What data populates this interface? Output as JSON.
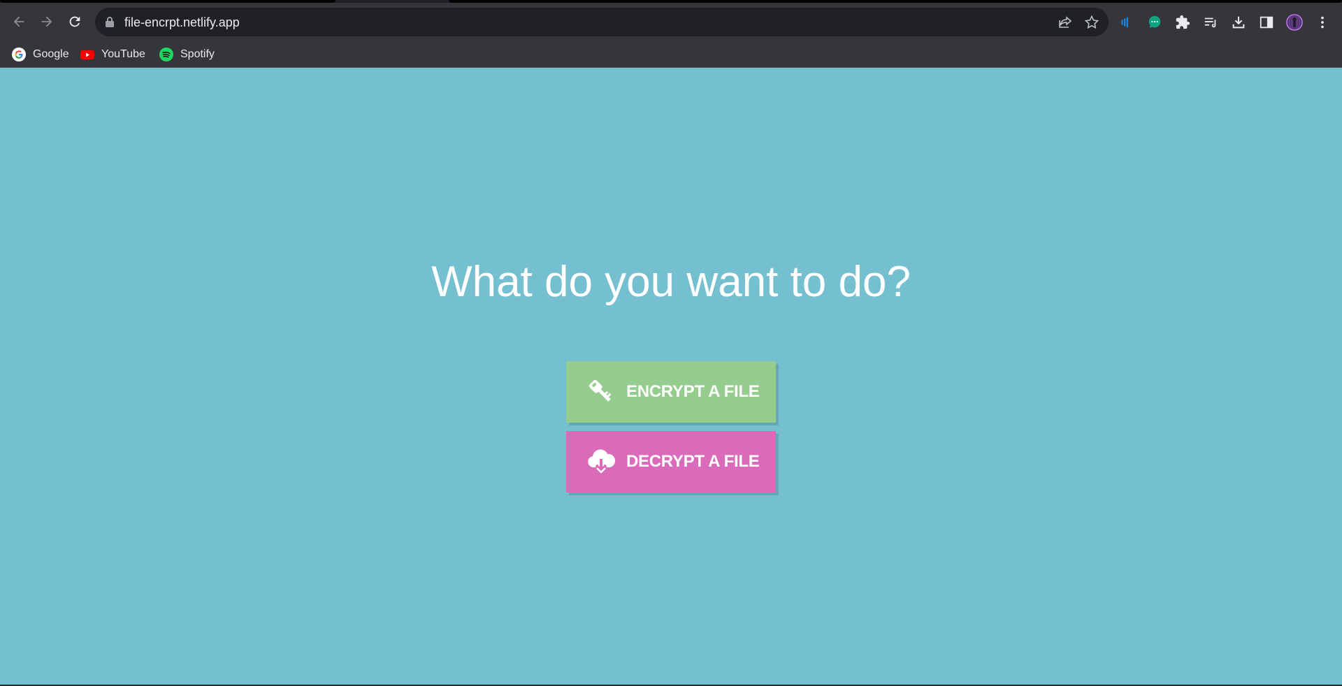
{
  "browser": {
    "url": "file-encrpt.netlify.app",
    "bookmarks": [
      {
        "label": "Google",
        "icon": "google-icon"
      },
      {
        "label": "YouTube",
        "icon": "youtube-icon"
      },
      {
        "label": "Spotify",
        "icon": "spotify-icon"
      }
    ]
  },
  "main": {
    "heading": "What do you want to do?",
    "encrypt_label": "ENCRYPT A FILE",
    "decrypt_label": "DECRYPT A FILE"
  },
  "colors": {
    "page_bg": "#74bfd0",
    "encrypt_bg": "#94cd8d",
    "decrypt_bg": "#da6bbb",
    "toolbar_bg": "#35363a"
  }
}
